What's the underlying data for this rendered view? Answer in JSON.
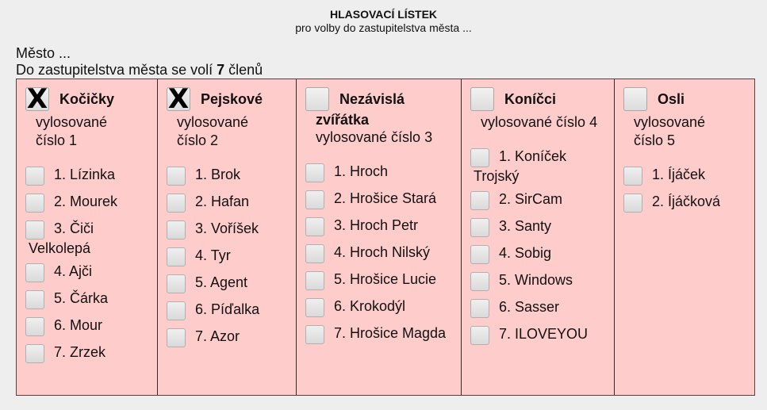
{
  "header": {
    "title": "HLASOVACÍ LÍSTEK",
    "subtitle": "pro volby do zastupitelstva města ..."
  },
  "info": {
    "city": "Město ...",
    "seats_prefix": "Do zastupitelstva města se volí",
    "seats_count": "7",
    "seats_suffix": "členů"
  },
  "colors": {
    "ballot_background": "#ffcccc",
    "page_background": "#eeeeee"
  },
  "parties": [
    {
      "name": "Kočičky",
      "draw": "vylosované číslo 1",
      "checked": true,
      "candidates": [
        "1. Lízinka",
        "2. Mourek",
        "3. Čiči Velkolepá",
        "4. Ajči",
        "5. Čárka",
        "6. Mour",
        "7. Zrzek"
      ]
    },
    {
      "name": "Pejskové",
      "draw": "vylosované číslo 2",
      "checked": true,
      "candidates": [
        "1. Brok",
        "2. Hafan",
        "3. Voříšek",
        "4. Tyr",
        "5. Agent",
        "6. Píďalka",
        "7. Azor"
      ]
    },
    {
      "name": "Nezávislá",
      "name_cont": "zvířátka",
      "draw": "vylosované číslo 3",
      "checked": false,
      "candidates": [
        "1. Hroch",
        "2. Hrošice Stará",
        "3. Hroch Petr",
        "4. Hroch Nilský",
        "5. Hrošice Lucie",
        "6. Krokodýl",
        "7. Hrošice Magda"
      ]
    },
    {
      "name": "Koníčci",
      "draw": "vylosované číslo 4",
      "checked": false,
      "candidates": [
        "1. Koníček Trojský",
        "2. SirCam",
        "3. Santy",
        "4. Sobig",
        "5. Windows",
        "6. Sasser",
        "7. ILOVEYOU"
      ]
    },
    {
      "name": "Osli",
      "draw": "vylosované číslo 5",
      "checked": false,
      "candidates": [
        "1. Íjáček",
        "2. Íjáčková"
      ]
    }
  ],
  "check_mark": "X"
}
